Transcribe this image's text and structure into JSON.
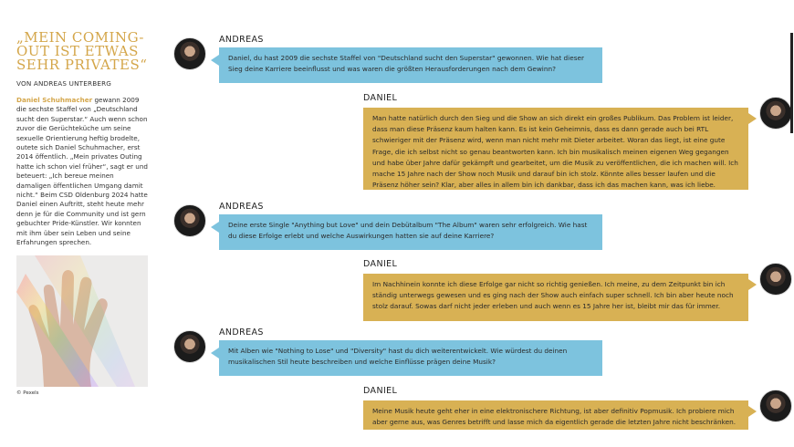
{
  "article": {
    "headline": "„MEIN COMING-OUT IST ETWAS SEHR PRIVATES“",
    "byline": "VON ANDREAS UNTERBERG",
    "intro_name": "Daniel Schuhmacher",
    "intro_text": " gewann 2009 die sechste Staffel von „Deutschland sucht den Superstar.“ Auch wenn schon zuvor die Gerüchteküche um seine sexuelle Orientierung heftig brodelte, outete sich Daniel Schuhmacher, erst 2014 öffentlich. „Mein privates Outing hatte ich schon viel früher“, sagt er und beteuert: „Ich bereue meinen damaligen öffentlichen Umgang damit nicht.“ Beim CSD Oldenburg 2024 hatte Daniel einen Auftritt, steht heute mehr denn je für die Community und ist gern gebuchter Pride-Künstler. Wir konnten mit ihm über sein Leben und seine Erfahrungen sprechen.",
    "photo_credit": "© Pexels"
  },
  "chat": [
    {
      "speaker": "ANDREAS",
      "text": "Daniel, du hast 2009 die sechste Staffel von \"Deutschland sucht den Superstar\" gewonnen. Wie hat dieser Sieg deine Karriere beeinflusst und was waren die größten Herausforderungen nach dem Gewinn?"
    },
    {
      "speaker": "DANIEL",
      "text": "Man hatte natürlich durch den Sieg und die Show an sich direkt ein großes Publikum. Das Problem ist leider, dass man diese Präsenz kaum halten kann. Es ist kein Geheimnis, dass es dann gerade auch bei RTL schwieriger mit der Präsenz wird, wenn man nicht mehr mit Dieter arbeitet. Woran das liegt, ist eine gute Frage, die ich selbst nicht so genau beantworten kann. Ich bin musikalisch meinen eigenen Weg gegangen und habe über Jahre dafür gekämpft und gearbeitet, um die Musik zu veröffentlichen, die ich machen will. Ich mache 15 Jahre nach der Show noch Musik und darauf bin ich stolz. Könnte alles besser laufen und die Präsenz höher sein? Klar, aber alles in allem bin ich dankbar, dass ich das machen kann, was ich liebe."
    },
    {
      "speaker": "ANDREAS",
      "text": "Deine erste Single \"Anything but Love\" und dein Debütalbum \"The Album\" waren sehr erfolgreich. Wie hast du diese Erfolge erlebt und welche Auswirkungen hatten sie auf deine Karriere?"
    },
    {
      "speaker": "DANIEL",
      "text": "Im Nachhinein konnte ich diese Erfolge gar nicht so richtig genießen. Ich meine, zu dem Zeitpunkt bin ich ständig unterwegs gewesen und es ging nach der Show auch einfach super schnell. Ich bin aber heute noch stolz darauf. Sowas darf nicht jeder erleben und auch wenn es 15 Jahre her ist, bleibt mir das für immer."
    },
    {
      "speaker": "ANDREAS",
      "text": "Mit Alben wie \"Nothing to Lose\" und \"Diversity\" hast du dich weiterentwickelt. Wie würdest du deinen musikalischen Stil heute beschreiben und welche Einflüsse prägen deine Musik?"
    },
    {
      "speaker": "DANIEL",
      "text": "Meine Musik heute geht eher in eine elektronischere Richtung, ist aber definitiv Popmusik. Ich probiere mich aber gerne aus, was Genres betrifft und lasse mich da eigentlich gerade die letzten Jahre nicht beschränken. Einige Einflüsse da sind, anders als bisher, eher Alternative..."
    }
  ]
}
